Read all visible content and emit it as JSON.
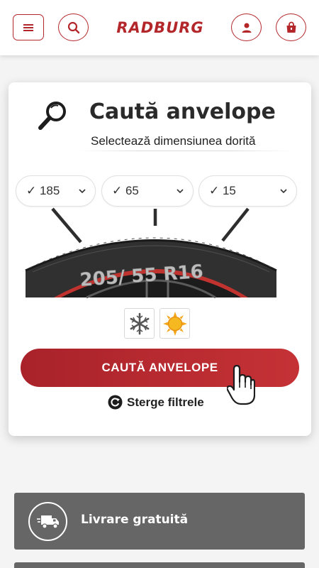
{
  "header": {
    "logo_text": "RADBURG",
    "icons": [
      "menu-icon",
      "search-icon",
      "user-icon",
      "shopping-bag-icon"
    ],
    "accent_color": "#b3262a"
  },
  "search_card": {
    "title": "Caută anvelope",
    "subtitle": "Selectează dimensiunea dorită",
    "selects": [
      {
        "value": "✓ 185"
      },
      {
        "value": "✓ 65"
      },
      {
        "value": "✓ 15"
      }
    ],
    "tire_sidewall_text": "205/ 55 R16",
    "seasons": [
      "snowflake-icon",
      "sun-icon"
    ],
    "cta_label": "CAUTĂ ANVELOPE",
    "clear_label": "Sterge filtrele"
  },
  "features": [
    {
      "label": "Livrare gratuită",
      "icon": "delivery-truck-icon"
    }
  ]
}
